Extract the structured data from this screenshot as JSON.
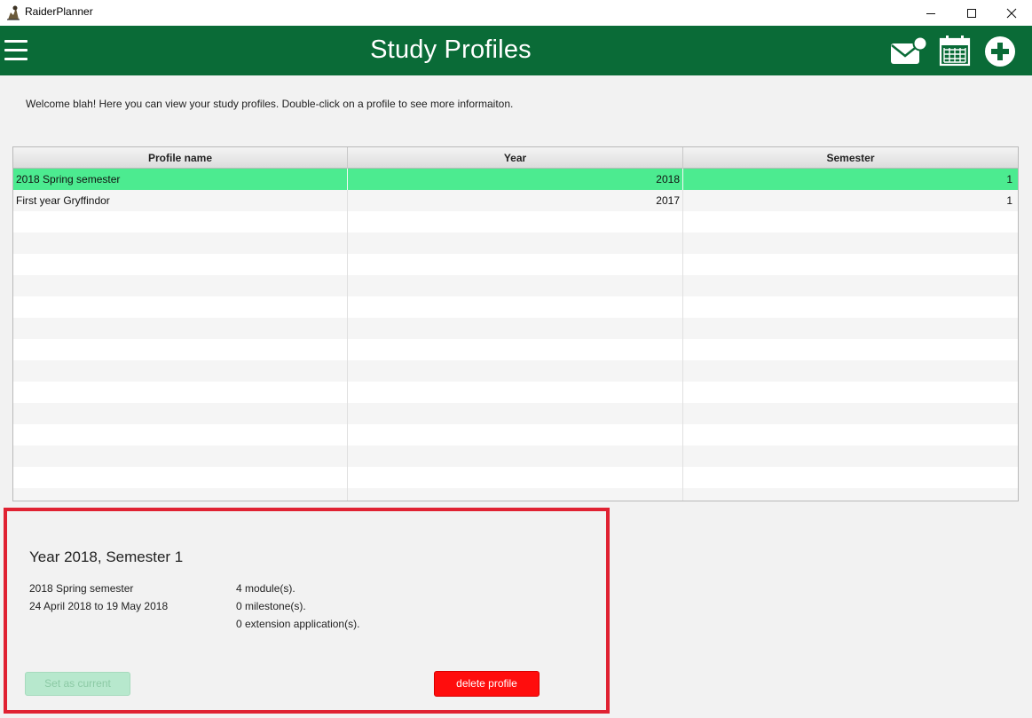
{
  "window": {
    "app_title": "RaiderPlanner",
    "minimize_icon": "minimize-icon",
    "maximize_icon": "maximize-icon",
    "close_icon": "close-icon"
  },
  "header": {
    "title": "Study Profiles",
    "background_color": "#0a6b37",
    "menu_icon": "hamburger-menu-icon",
    "notifications_icon": "mail-notification-icon",
    "calendar_icon": "calendar-icon",
    "add_icon": "add-circle-icon"
  },
  "welcome_text": "Welcome blah! Here you can view your study profiles. Double-click on a profile to see more informaiton.",
  "table": {
    "columns": [
      "Profile name",
      "Year",
      "Semester"
    ],
    "rows": [
      {
        "name": "2018 Spring semester",
        "year": "2018",
        "semester": "1",
        "selected": true
      },
      {
        "name": "First year Gryffindor",
        "year": "2017",
        "semester": "1",
        "selected": false
      }
    ],
    "selected_row_color": "#4ceb90"
  },
  "detail": {
    "heading": "Year 2018, Semester 1",
    "profile_name": "2018 Spring semester",
    "date_range": "24 April 2018 to 19 May 2018",
    "modules": "4 module(s).",
    "milestones": "0 milestone(s).",
    "extensions": "0 extension application(s).",
    "set_current_label": "Set as current",
    "delete_label": "delete profile",
    "highlight_border_color": "#e02232",
    "delete_color": "#ff0d0d"
  }
}
